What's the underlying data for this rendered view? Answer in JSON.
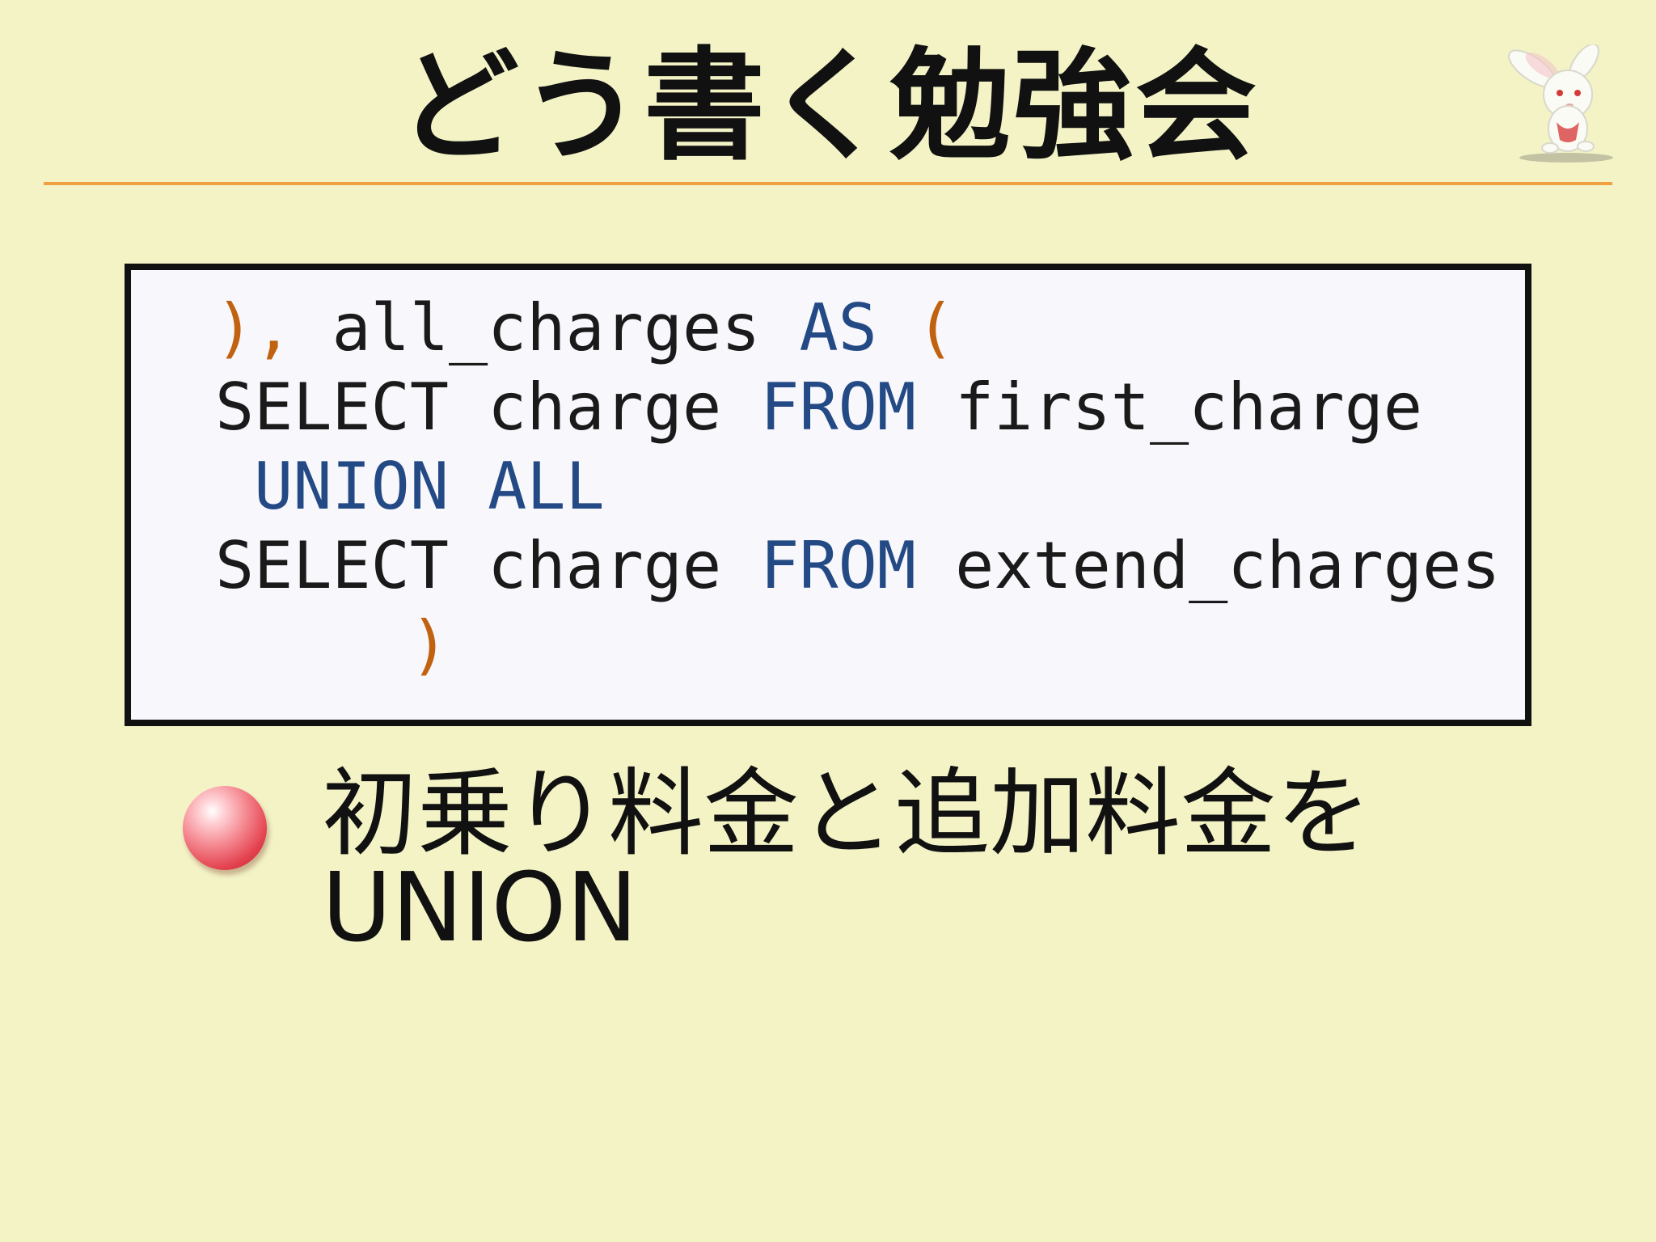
{
  "slide": {
    "title": "どう書く勉強会",
    "mascot_icon": "white-rabbit-mascot-icon",
    "accent_color": "#f0a040",
    "background_color": "#f3f3c6"
  },
  "code_block": {
    "keyword_color": "#234a85",
    "paren_color": "#c0620f",
    "lines": [
      {
        "tokens": [
          {
            "type": "paren",
            "text": ")"
          },
          {
            "type": "paren",
            "text": ","
          },
          {
            "type": "plain",
            "text": " all_charges "
          },
          {
            "type": "kw",
            "text": "AS"
          },
          {
            "type": "plain",
            "text": " "
          },
          {
            "type": "paren",
            "text": "("
          }
        ]
      },
      {
        "tokens": [
          {
            "type": "plain",
            "text": "SELECT charge "
          },
          {
            "type": "kw",
            "text": "FROM"
          },
          {
            "type": "plain",
            "text": " first_charge"
          }
        ]
      },
      {
        "tokens": [
          {
            "type": "plain",
            "text": " "
          },
          {
            "type": "kw",
            "text": "UNION ALL"
          }
        ]
      },
      {
        "tokens": [
          {
            "type": "plain",
            "text": "SELECT charge "
          },
          {
            "type": "kw",
            "text": "FROM"
          },
          {
            "type": "plain",
            "text": " extend_charges"
          }
        ]
      },
      {
        "tokens": [
          {
            "type": "plain",
            "text": "     "
          },
          {
            "type": "paren",
            "text": ")"
          }
        ]
      }
    ]
  },
  "bullets": [
    {
      "icon": "red-sphere-bullet-icon",
      "text_line1": "初乗り料金と追加料金を",
      "text_line2": "UNION"
    }
  ]
}
